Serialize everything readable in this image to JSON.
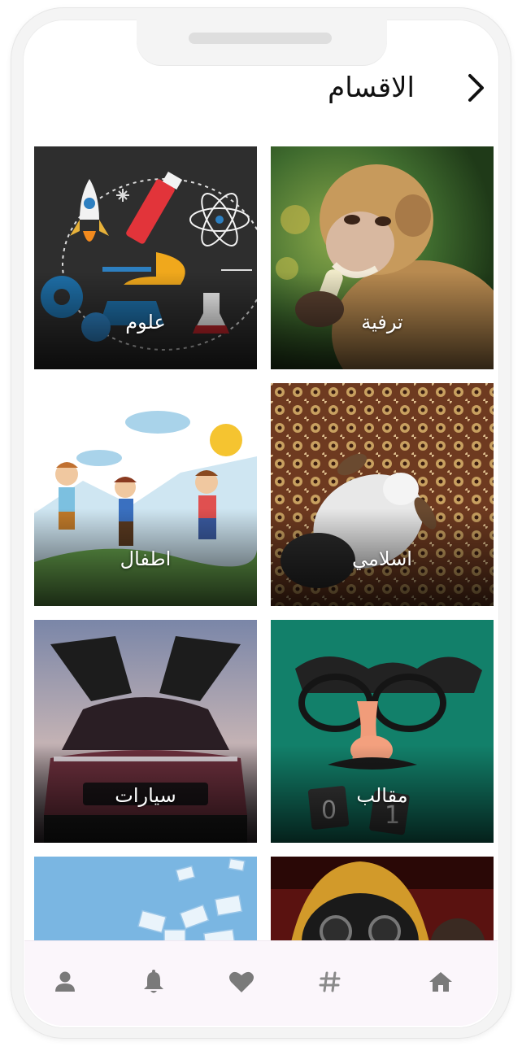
{
  "header": {
    "title": "الاقسام",
    "back_icon": "chevron-right-icon"
  },
  "categories": [
    {
      "label": "ترفية",
      "image": "monkey-photo"
    },
    {
      "label": "علوم",
      "image": "science-illustration"
    },
    {
      "label": "اسلامي",
      "image": "prayer-on-carpet-photo"
    },
    {
      "label": "اطفال",
      "image": "children-jumping-illustration"
    },
    {
      "label": "مقالب",
      "image": "fake-nose-glasses-photo"
    },
    {
      "label": "سيارات",
      "image": "gullwing-car-photo"
    },
    {
      "label": "",
      "image": "hooded-gas-mask-photo"
    },
    {
      "label": "",
      "image": "flying-envelopes-illustration"
    }
  ],
  "bottom_nav": [
    {
      "icon": "home-icon",
      "active": true
    },
    {
      "icon": "hashtag-icon",
      "active": false
    },
    {
      "icon": "heart-icon",
      "active": false
    },
    {
      "icon": "bell-icon",
      "active": false
    },
    {
      "icon": "user-icon",
      "active": false
    }
  ],
  "colors": {
    "nav_icon": "#7a7a7a",
    "nav_background": "#fbf6fb",
    "title": "#111111"
  }
}
